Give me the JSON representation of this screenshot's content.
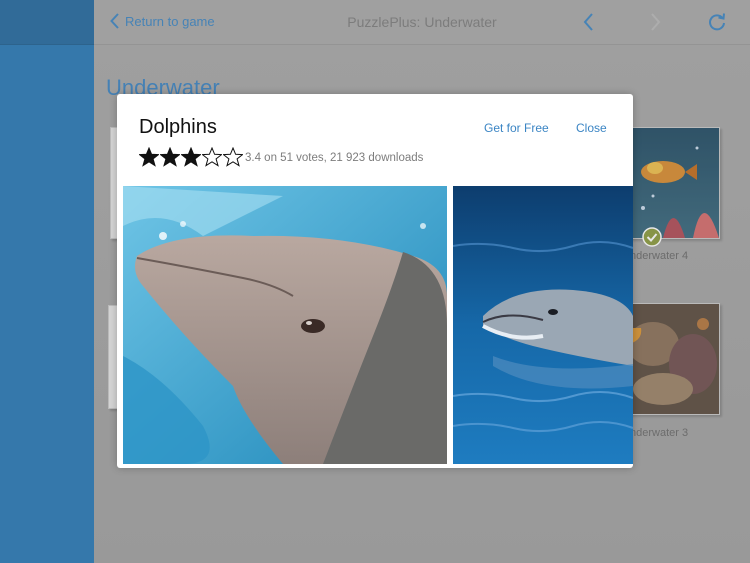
{
  "nav": {
    "back_label": "Return to game",
    "title": "PuzzlePlus: Underwater",
    "prev_icon": "chevron-left-icon",
    "next_icon": "chevron-right-icon",
    "refresh_icon": "refresh-icon"
  },
  "section": {
    "title": "Underwater"
  },
  "thumbnails": [
    {
      "label": "nderwater 4",
      "completed": true
    },
    {
      "label": "nderwater 3",
      "completed": false
    }
  ],
  "modal": {
    "title": "Dolphins",
    "get_label": "Get for Free",
    "close_label": "Close",
    "rating": 3.4,
    "rating_max": 5,
    "rating_text": "3.4 on 51 votes, 21 923 downloads"
  },
  "colors": {
    "accent": "#3b85c4",
    "sidebar": "#2778b6",
    "check": "#8a9a3c",
    "star": "#111111"
  }
}
